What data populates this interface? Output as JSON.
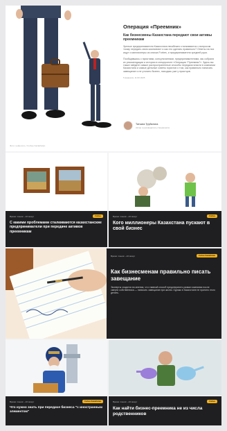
{
  "hero": {
    "title": "Операция «Преемник»",
    "subtitle": "Как бизнесмены Казахстана передают свои активы преемникам",
    "paragraph1": "Зрелые предприниматели Казахстана неизбежно сталкиваются с вопросом «кому передать свою компанию» и как это сделать правильно? Ответы на них ищут и миллионеры из списка Forbes, и предприниматели средней руки.",
    "paragraph2": "Пообщавшись с юристами, консультантами, предпринимателями, мы собрали их рекомендации и истории в спецпроекте «Операция “Преемник”». Здесь вы также найдете самые распространенные способы передачи власти в компании Казахстана и самые дельные советы юристов о том, как правильно написать завещание и не утопить бизнес, находясь уже у праотцов.",
    "date": "5 февраля, 11:00 2025",
    "caption": "Фото: нейросеть / Forbes Kazakhstan",
    "author_name": "Татьяна Трубилина",
    "author_role": "Автор и руководитель спецпроекта"
  },
  "cards": [
    {
      "meta": "Время чтения: ~10 минут",
      "badge": "Forbes",
      "title": "С какими проблемами сталкиваются казахстанские предприниматели при передаче активов преемникам"
    },
    {
      "meta": "Время чтения: ~10 минут",
      "badge": "Forbes",
      "title": "Кого миллионеры Казахстана пускают в свой бизнес"
    },
    {
      "meta": "Время чтения: ~10 минут",
      "badge": "Forbes Kazakhstan",
      "title": "Как бизнесменам правильно писать завещание",
      "desc": "Эксперты сходятся во мнении, что главный способ предотвратить развал компании после смерти собственника — написать завещание при жизни. Однако в Казахстане не принято этого делать."
    },
    {
      "meta": "Время чтения: ~10 минут",
      "badge": "Forbes Kazakhstan",
      "title": "Что нужно знать при передаче бизнеса \"с иностранным элементом\""
    },
    {
      "meta": "Время чтения: ~10 минут",
      "badge": "Forbes",
      "title": "Как найти бизнес-преемника не из числа родственников"
    }
  ],
  "colors": {
    "accent": "#f2b01e",
    "dark": "#1f1f22"
  }
}
